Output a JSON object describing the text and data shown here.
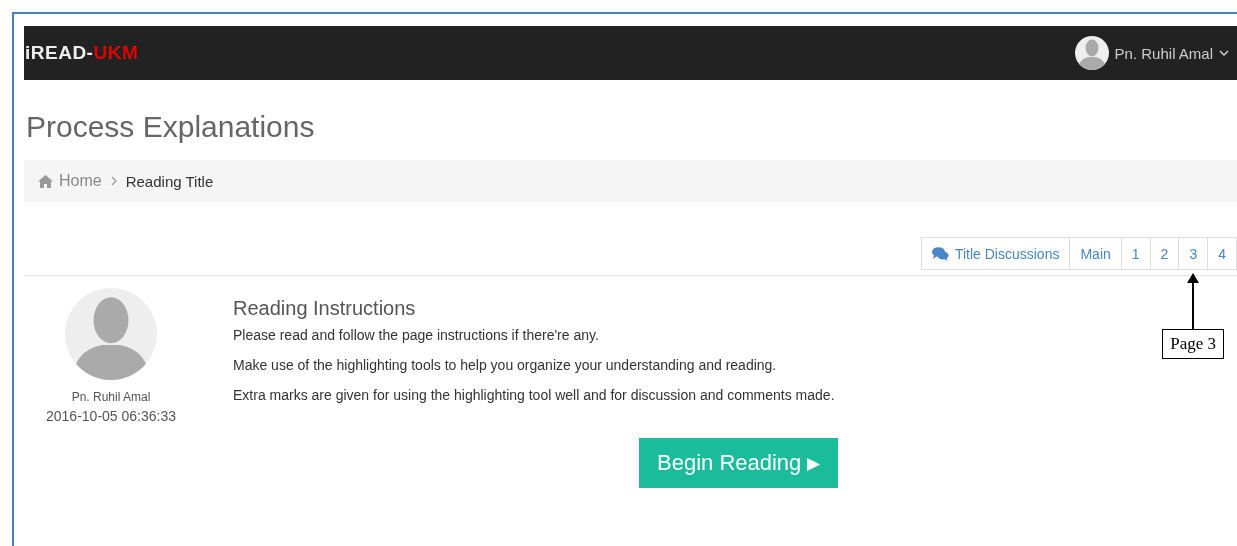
{
  "navbar": {
    "brand": "iREAD-",
    "brand_accent": "UKM",
    "user": "Pn. Ruhil Amal"
  },
  "page_title": "Process Explanations",
  "breadcrumb": [
    "Home",
    "Reading Title"
  ],
  "page_nav": [
    {
      "kind": "discussion",
      "label": "Title Discussions"
    },
    {
      "kind": "page",
      "label": "Main"
    },
    {
      "kind": "page",
      "label": "1"
    },
    {
      "kind": "page",
      "label": "2"
    },
    {
      "kind": "page",
      "label": "3"
    },
    {
      "kind": "page",
      "label": "4"
    }
  ],
  "author": {
    "name": "Pn. Ruhil Amal",
    "timestamp": "2016-10-05 06:36:33"
  },
  "instructions": {
    "heading": "Reading Instructions",
    "lines": [
      "Please read and follow the page instructions if there're any.",
      "Make use of the highlighting tools to help you organize your understanding and reading.",
      "Extra marks are given for using the highlighting tool well and for discussion and comments made."
    ]
  },
  "begin_button": {
    "label": "Begin Reading",
    "arrow": "▶"
  },
  "annotation": {
    "label": "Page 3"
  }
}
